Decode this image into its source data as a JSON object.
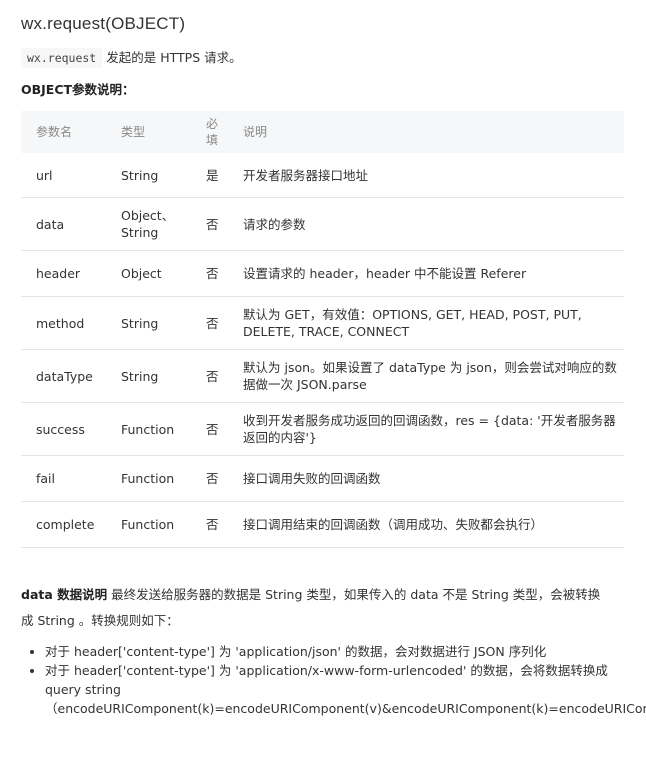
{
  "title": "wx.request(OBJECT)",
  "intro": {
    "code": "wx.request",
    "text": "发起的是 HTTPS 请求。"
  },
  "subheading": "OBJECT参数说明：",
  "table": {
    "headers": {
      "name": "参数名",
      "type": "类型",
      "required": "必填",
      "description": "说明"
    },
    "rows": [
      {
        "name": "url",
        "type": "String",
        "required": "是",
        "description": "开发者服务器接口地址"
      },
      {
        "name": "data",
        "type": "Object、String",
        "required": "否",
        "description": "请求的参数"
      },
      {
        "name": "header",
        "type": "Object",
        "required": "否",
        "description": "设置请求的 header，header 中不能设置 Referer"
      },
      {
        "name": "method",
        "type": "String",
        "required": "否",
        "description": "默认为 GET，有效值：OPTIONS, GET, HEAD, POST, PUT, DELETE, TRACE, CONNECT"
      },
      {
        "name": "dataType",
        "type": "String",
        "required": "否",
        "description": "默认为 json。如果设置了 dataType 为 json，则会尝试对响应的数据做一次 JSON.parse"
      },
      {
        "name": "success",
        "type": "Function",
        "required": "否",
        "description": "收到开发者服务成功返回的回调函数，res = {data: '开发者服务器返回的内容'}"
      },
      {
        "name": "fail",
        "type": "Function",
        "required": "否",
        "description": "接口调用失败的回调函数"
      },
      {
        "name": "complete",
        "type": "Function",
        "required": "否",
        "description": "接口调用结束的回调函数（调用成功、失败都会执行）"
      }
    ]
  },
  "data_note": {
    "label": "data 数据说明",
    "text": "最终发送给服务器的数据是 String 类型，如果传入的 data 不是 String 类型，会被转换成 String 。转换规则如下："
  },
  "rules": [
    "对于 header['content-type'] 为 'application/json' 的数据，会对数据进行 JSON 序列化",
    "对于 header['content-type'] 为 'application/x-www-form-urlencoded' 的数据，会将数据转换成 query string"
  ],
  "rule_example": "（encodeURIComponent(k)=encodeURIComponent(v)&encodeURIComponent(k)=encodeURIComponent(v)...）"
}
